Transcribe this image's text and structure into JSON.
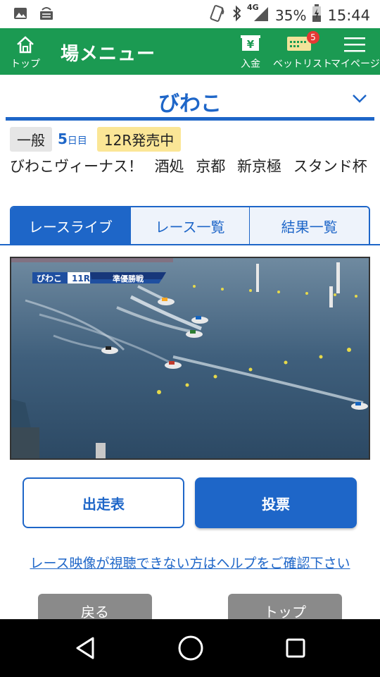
{
  "status_bar": {
    "network": "4G",
    "battery": "35%",
    "time": "15:44"
  },
  "header": {
    "home_label": "トップ",
    "title": "場メニュー",
    "deposit_label": "入金",
    "deposit_symbol": "¥",
    "betlist_label": "ベットリスト",
    "betlist_badge": "5",
    "mypage_label": "マイページ",
    "colors": {
      "background": "#1b9a52",
      "badge": "#e53935"
    }
  },
  "venue": {
    "name": "びわこ",
    "accent": "#1e66c8"
  },
  "race_info": {
    "grade": "一般",
    "day_number": "5",
    "day_suffix": "日目",
    "sale_status": "12R発売中",
    "race_title": "びわこヴィーナス！ 酒処 京都 新京極 スタンド杯"
  },
  "tabs": [
    {
      "label": "レースライブ",
      "active": true
    },
    {
      "label": "レース一覧",
      "active": false
    },
    {
      "label": "結果一覧",
      "active": false
    }
  ],
  "video_overlay": {
    "venue": "びわこ",
    "race": "11R",
    "stage": "準優勝戦"
  },
  "buttons": {
    "entry_table": "出走表",
    "vote": "投票"
  },
  "help_link": "レース映像が視聴できない方はヘルプをご確認下さい",
  "bottom_buttons": {
    "back": "戻る",
    "top": "トップ"
  }
}
